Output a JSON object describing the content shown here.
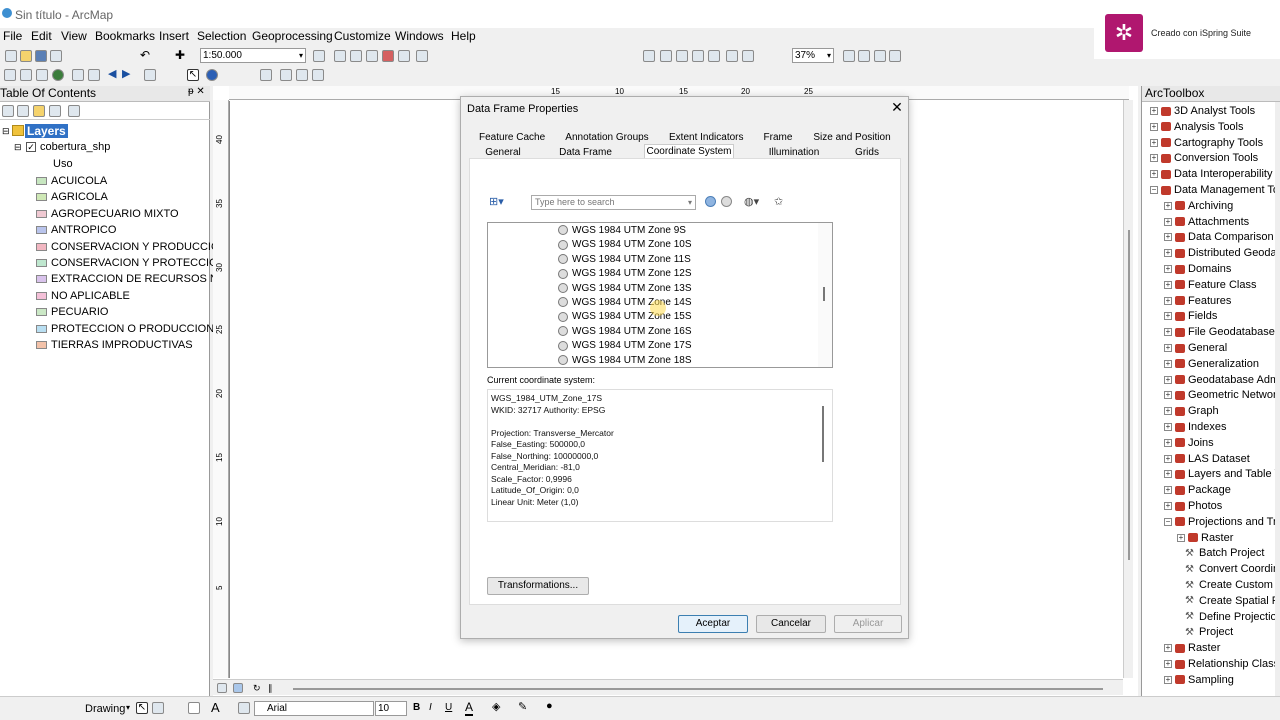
{
  "window": {
    "title": "Sin título - ArcMap"
  },
  "menu": [
    "File",
    "Edit",
    "View",
    "Bookmarks",
    "Insert",
    "Selection",
    "Geoprocessing",
    "Customize",
    "Windows",
    "Help"
  ],
  "toolbar": {
    "scale": "1:50.000",
    "zoom": "37%"
  },
  "ispring": {
    "label": "Creado con iSpring Suite"
  },
  "toc": {
    "title": "Table Of Contents",
    "pin": "ᵽ ✕",
    "layers": "Layers",
    "layer_name": "cobertura_shp",
    "field": "Uso",
    "items": [
      {
        "label": "ACUICOLA",
        "color": "#c7e6c0"
      },
      {
        "label": "AGRICOLA",
        "color": "#cfe8b6"
      },
      {
        "label": "AGROPECUARIO MIXTO",
        "color": "#f0c9d2"
      },
      {
        "label": "ANTROPICO",
        "color": "#b9c4ec"
      },
      {
        "label": "CONSERVACION Y PRODUCCION",
        "color": "#f2b7c2"
      },
      {
        "label": "CONSERVACION Y PROTECCION",
        "color": "#bfe7cf"
      },
      {
        "label": "EXTRACCION DE RECURSOS NAT",
        "color": "#d9c3ec"
      },
      {
        "label": "NO APLICABLE",
        "color": "#f4c0d8"
      },
      {
        "label": "PECUARIO",
        "color": "#cbe8c6"
      },
      {
        "label": "PROTECCION O PRODUCCION",
        "color": "#b9dff2"
      },
      {
        "label": "TIERRAS IMPRODUCTIVAS",
        "color": "#f3c2a9"
      }
    ]
  },
  "ruler": {
    "h": [
      "15",
      "10",
      "15",
      "20",
      "25"
    ],
    "v": [
      "40",
      "35",
      "30",
      "25",
      "20",
      "15",
      "10",
      "5"
    ]
  },
  "arctoolbox": {
    "title": "ArcToolbox",
    "items": [
      {
        "label": "3D Analyst Tools",
        "level": 0,
        "kind": "toolbox",
        "pm": "+"
      },
      {
        "label": "Analysis Tools",
        "level": 0,
        "kind": "toolbox",
        "pm": "+"
      },
      {
        "label": "Cartography Tools",
        "level": 0,
        "kind": "toolbox",
        "pm": "+"
      },
      {
        "label": "Conversion Tools",
        "level": 0,
        "kind": "toolbox",
        "pm": "+"
      },
      {
        "label": "Data Interoperability T",
        "level": 0,
        "kind": "toolbox",
        "pm": "+"
      },
      {
        "label": "Data Management Too",
        "level": 0,
        "kind": "toolbox",
        "pm": "-"
      },
      {
        "label": "Archiving",
        "level": 1,
        "kind": "toolbox",
        "pm": "+"
      },
      {
        "label": "Attachments",
        "level": 1,
        "kind": "toolbox",
        "pm": "+"
      },
      {
        "label": "Data Comparison",
        "level": 1,
        "kind": "toolbox",
        "pm": "+"
      },
      {
        "label": "Distributed Geodata",
        "level": 1,
        "kind": "toolbox",
        "pm": "+"
      },
      {
        "label": "Domains",
        "level": 1,
        "kind": "toolbox",
        "pm": "+"
      },
      {
        "label": "Feature Class",
        "level": 1,
        "kind": "toolbox",
        "pm": "+"
      },
      {
        "label": "Features",
        "level": 1,
        "kind": "toolbox",
        "pm": "+"
      },
      {
        "label": "Fields",
        "level": 1,
        "kind": "toolbox",
        "pm": "+"
      },
      {
        "label": "File Geodatabase",
        "level": 1,
        "kind": "toolbox",
        "pm": "+"
      },
      {
        "label": "General",
        "level": 1,
        "kind": "toolbox",
        "pm": "+"
      },
      {
        "label": "Generalization",
        "level": 1,
        "kind": "toolbox",
        "pm": "+"
      },
      {
        "label": "Geodatabase Admi",
        "level": 1,
        "kind": "toolbox",
        "pm": "+"
      },
      {
        "label": "Geometric Network",
        "level": 1,
        "kind": "toolbox",
        "pm": "+"
      },
      {
        "label": "Graph",
        "level": 1,
        "kind": "toolbox",
        "pm": "+"
      },
      {
        "label": "Indexes",
        "level": 1,
        "kind": "toolbox",
        "pm": "+"
      },
      {
        "label": "Joins",
        "level": 1,
        "kind": "toolbox",
        "pm": "+"
      },
      {
        "label": "LAS Dataset",
        "level": 1,
        "kind": "toolbox",
        "pm": "+"
      },
      {
        "label": "Layers and Table Vi",
        "level": 1,
        "kind": "toolbox",
        "pm": "+"
      },
      {
        "label": "Package",
        "level": 1,
        "kind": "toolbox",
        "pm": "+"
      },
      {
        "label": "Photos",
        "level": 1,
        "kind": "toolbox",
        "pm": "+"
      },
      {
        "label": "Projections and Tra",
        "level": 1,
        "kind": "toolbox",
        "pm": "-"
      },
      {
        "label": "Raster",
        "level": 2,
        "kind": "toolbox",
        "pm": "+"
      },
      {
        "label": "Batch Project",
        "level": 2,
        "kind": "tool",
        "pm": ""
      },
      {
        "label": "Convert Coordin",
        "level": 2,
        "kind": "tool",
        "pm": ""
      },
      {
        "label": "Create Custom G",
        "level": 2,
        "kind": "tool",
        "pm": ""
      },
      {
        "label": "Create Spatial Re",
        "level": 2,
        "kind": "tool",
        "pm": ""
      },
      {
        "label": "Define Projection",
        "level": 2,
        "kind": "tool",
        "pm": ""
      },
      {
        "label": "Project",
        "level": 2,
        "kind": "tool",
        "pm": ""
      },
      {
        "label": "Raster",
        "level": 1,
        "kind": "toolbox",
        "pm": "+"
      },
      {
        "label": "Relationship Classes",
        "level": 1,
        "kind": "toolbox",
        "pm": "+"
      },
      {
        "label": "Sampling",
        "level": 1,
        "kind": "toolbox",
        "pm": "+"
      }
    ]
  },
  "dialog": {
    "title": "Data Frame Properties",
    "tabs_row1": [
      "Feature Cache",
      "Annotation Groups",
      "Extent Indicators",
      "Frame",
      "Size and Position"
    ],
    "tabs_row2": [
      "General",
      "Data Frame",
      "Coordinate System",
      "Illumination",
      "Grids"
    ],
    "search_placeholder": "Type here to search",
    "list": [
      "WGS 1984 UTM Zone  9S",
      "WGS 1984 UTM Zone 10S",
      "WGS 1984 UTM Zone 11S",
      "WGS 1984 UTM Zone 12S",
      "WGS 1984 UTM Zone 13S",
      "WGS 1984 UTM Zone 14S",
      "WGS 1984 UTM Zone 15S",
      "WGS 1984 UTM Zone 16S",
      "WGS 1984 UTM Zone 17S",
      "WGS 1984 UTM Zone 18S"
    ],
    "current_label": "Current coordinate system:",
    "current_text": "WGS_1984_UTM_Zone_17S\nWKID: 32717 Authority: EPSG\n\nProjection: Transverse_Mercator\nFalse_Easting: 500000,0\nFalse_Northing: 10000000,0\nCentral_Meridian: -81,0\nScale_Factor: 0,9996\nLatitude_Of_Origin: 0,0\nLinear Unit: Meter (1,0)",
    "transformations": "Transformations...",
    "ok": "Aceptar",
    "cancel": "Cancelar",
    "apply": "Aplicar"
  },
  "statusbar": {
    "drawing": "Drawing",
    "font": "Arial",
    "size": "10"
  }
}
